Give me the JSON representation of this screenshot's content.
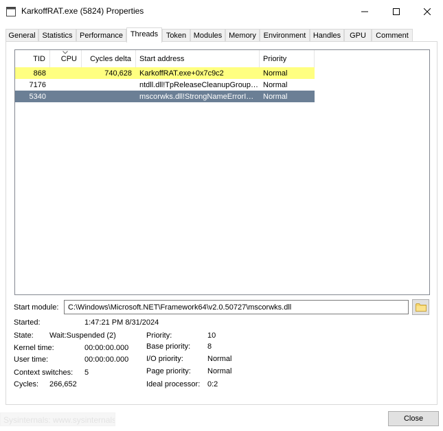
{
  "window": {
    "title": "KarkoffRAT.exe (5824) Properties",
    "minimize_glyph": "—",
    "maximize_glyph": "□",
    "close_glyph": "✕"
  },
  "tabs": [
    {
      "label": "General",
      "active": false
    },
    {
      "label": "Statistics",
      "active": false
    },
    {
      "label": "Performance",
      "active": false
    },
    {
      "label": "Threads",
      "active": true
    },
    {
      "label": "Token",
      "active": false
    },
    {
      "label": "Modules",
      "active": false
    },
    {
      "label": "Memory",
      "active": false
    },
    {
      "label": "Environment",
      "active": false
    },
    {
      "label": "Handles",
      "active": false
    },
    {
      "label": "GPU",
      "active": false
    },
    {
      "label": "Comment",
      "active": false
    }
  ],
  "threads": {
    "columns": [
      "TID",
      "CPU",
      "Cycles delta",
      "Start address",
      "Priority"
    ],
    "sorted_column": "CPU",
    "rows": [
      {
        "tid": "868",
        "cpu": "",
        "cycles_delta": "740,628",
        "start_address": "KarkoffRAT.exe+0x7c9c2",
        "priority": "Normal",
        "state": "highlighted"
      },
      {
        "tid": "7176",
        "cpu": "",
        "cycles_delta": "",
        "start_address": "ntdll.dll!TpReleaseCleanupGroup…",
        "priority": "Normal",
        "state": "normal"
      },
      {
        "tid": "5340",
        "cpu": "",
        "cycles_delta": "",
        "start_address": "mscorwks.dll!StrongNameErrorI…",
        "priority": "Normal",
        "state": "selected"
      }
    ]
  },
  "details": {
    "start_module_label": "Start module:",
    "start_module_value": "C:\\Windows\\Microsoft.NET\\Framework64\\v2.0.50727\\mscorwks.dll",
    "started_label": "Started:",
    "started_value": "1:47:21 PM 8/31/2024",
    "state_label": "State:",
    "state_value": "Wait:Suspended (2)",
    "kernel_time_label": "Kernel time:",
    "kernel_time_value": "00:00:00.000",
    "user_time_label": "User time:",
    "user_time_value": "00:00:00.000",
    "context_switches_label": "Context switches:",
    "context_switches_value": "5",
    "cycles_label": "Cycles:",
    "cycles_value": "266,652",
    "priority_label": "Priority:",
    "priority_value": "10",
    "base_priority_label": "Base priority:",
    "base_priority_value": "8",
    "io_priority_label": "I/O priority:",
    "io_priority_value": "Normal",
    "page_priority_label": "Page priority:",
    "page_priority_value": "Normal",
    "ideal_processor_label": "Ideal processor:",
    "ideal_processor_value": "0:2"
  },
  "footer": {
    "close_label": "Close",
    "watermark": "Sysinternals: www.sysinternals.com"
  },
  "colors": {
    "highlight_row": "#ffff80",
    "selected_row": "#6b7f95",
    "selected_text": "#ffffff"
  },
  "icons": {
    "app": "app-window-icon",
    "sort": "sort-caret-icon",
    "browse": "folder-icon"
  }
}
